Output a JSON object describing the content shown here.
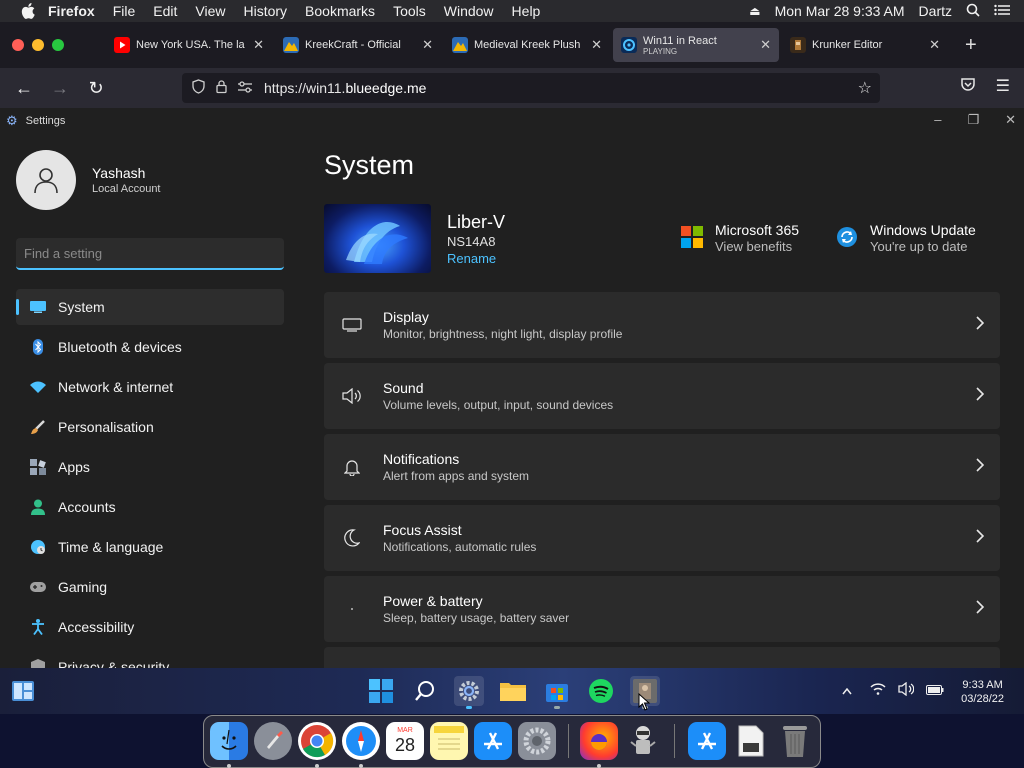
{
  "menubar": {
    "app": "Firefox",
    "items": [
      "File",
      "Edit",
      "View",
      "History",
      "Bookmarks",
      "Tools",
      "Window",
      "Help"
    ],
    "datetime": "Mon Mar 28  9:33 AM",
    "user": "Dartz"
  },
  "tabs": [
    {
      "title": "New York USA. The la",
      "favicon": "youtube-icon",
      "color": "#ff0000"
    },
    {
      "title": "KreekCraft - Official",
      "favicon": "kreekcraft-icon",
      "color": "#f2b705"
    },
    {
      "title": "Medieval Kreek Plush",
      "favicon": "kreekcraft-icon",
      "color": "#f2b705"
    },
    {
      "title": "Win11 in React",
      "subtitle": "PLAYING",
      "favicon": "win11-icon",
      "color": "#4cc2ff",
      "active": true
    },
    {
      "title": "Krunker Editor",
      "favicon": "krunker-icon",
      "color": "#b07a3a"
    }
  ],
  "navbar": {
    "url_prefix": "https://win11.",
    "url_domain": "blueedge.me"
  },
  "settings": {
    "window_title": "Settings",
    "profile": {
      "name": "Yashash",
      "type": "Local Account"
    },
    "search_placeholder": "Find a setting",
    "nav": [
      {
        "label": "System",
        "icon": "monitor-icon",
        "color": "#4cc2ff",
        "active": true
      },
      {
        "label": "Bluetooth & devices",
        "icon": "bluetooth-icon",
        "color": "#3a8ee6"
      },
      {
        "label": "Network & internet",
        "icon": "wifi-icon",
        "color": "#4cc2ff"
      },
      {
        "label": "Personalisation",
        "icon": "brush-icon",
        "color": "#e8a04a"
      },
      {
        "label": "Apps",
        "icon": "apps-icon",
        "color": "#9aa7b8"
      },
      {
        "label": "Accounts",
        "icon": "person-icon",
        "color": "#32c08a"
      },
      {
        "label": "Time & language",
        "icon": "globe-clock-icon",
        "color": "#4cc2ff"
      },
      {
        "label": "Gaming",
        "icon": "gamepad-icon",
        "color": "#a0a0a0"
      },
      {
        "label": "Accessibility",
        "icon": "accessibility-icon",
        "color": "#4cc2ff"
      },
      {
        "label": "Privacy & security",
        "icon": "shield-icon",
        "color": "#a0a0a0"
      }
    ],
    "page_title": "System",
    "device": {
      "name": "Liber-V",
      "model": "NS14A8",
      "rename": "Rename"
    },
    "quick": [
      {
        "title": "Microsoft 365",
        "sub": "View benefits",
        "icon": "microsoft-logo-icon"
      },
      {
        "title": "Windows Update",
        "sub": "You're up to date",
        "icon": "refresh-icon"
      }
    ],
    "cards": [
      {
        "title": "Display",
        "sub": "Monitor, brightness, night light, display profile",
        "icon": "display-icon"
      },
      {
        "title": "Sound",
        "sub": "Volume levels, output, input, sound devices",
        "icon": "speaker-icon"
      },
      {
        "title": "Notifications",
        "sub": "Alert from apps and system",
        "icon": "bell-icon"
      },
      {
        "title": "Focus Assist",
        "sub": "Notifications, automatic rules",
        "icon": "moon-icon"
      },
      {
        "title": "Power & battery",
        "sub": "Sleep, battery usage, battery saver",
        "icon": "power-icon"
      }
    ]
  },
  "taskbar": {
    "time": "9:33 AM",
    "date": "03/28/22",
    "apps": [
      "windows-start-icon",
      "search-icon",
      "settings-icon",
      "file-explorer-icon",
      "store-icon",
      "spotify-icon",
      "photo-icon"
    ]
  },
  "dock": {
    "apps": [
      "finder-icon",
      "launchpad-icon",
      "chrome-icon",
      "safari-icon",
      "calendar-icon",
      "notes-icon",
      "app-store-icon",
      "system-preferences-icon",
      "firefox-icon",
      "automator-icon",
      "app-store-icon",
      "file-icon",
      "trash-icon"
    ],
    "calendar_month": "MAR",
    "calendar_day": "28"
  }
}
